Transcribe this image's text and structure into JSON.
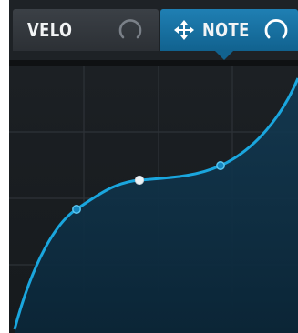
{
  "tabs": [
    {
      "label": "VELO",
      "selected": false,
      "knob_icon": "knob-arc-icon"
    },
    {
      "label": "NOTE",
      "selected": true,
      "move_icon": "move-arrows-icon",
      "knob_icon": "knob-arc-icon"
    }
  ],
  "graph": {
    "curve_color": "#1aa6de",
    "grid_color": "#2e3338",
    "control_points": [
      {
        "type": "endpoint"
      },
      {
        "type": "handle"
      },
      {
        "type": "selected"
      },
      {
        "type": "handle"
      },
      {
        "type": "endpoint"
      }
    ]
  },
  "colors": {
    "accent": "#1680b8",
    "panel_bg": "#1b1f23"
  }
}
